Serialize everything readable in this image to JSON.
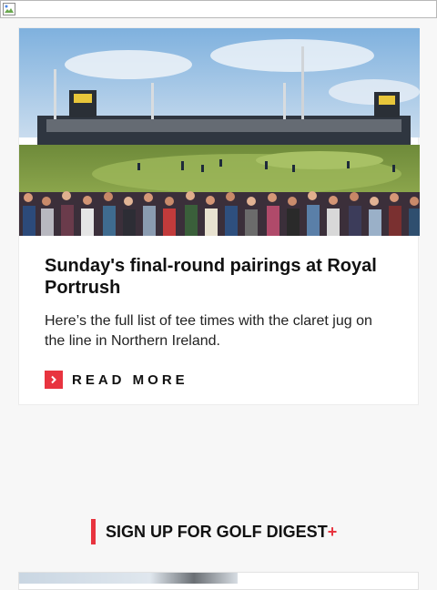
{
  "top_image": {
    "icon": "broken-image-icon"
  },
  "article": {
    "image_icon": "golf-course-photo",
    "headline": "Sunday's final-round pairings at Royal Portrush",
    "dek": "Here’s the full list of tee times with the claret jug on the line in Northern Ireland.",
    "read_more_label": "READ MORE",
    "read_more_icon": "chevron-right-icon"
  },
  "signup": {
    "label": "SIGN UP FOR GOLF DIGEST",
    "plus": "+"
  },
  "colors": {
    "accent": "#e8343f",
    "background": "#f7f7f7",
    "card": "#ffffff",
    "text": "#111111"
  }
}
